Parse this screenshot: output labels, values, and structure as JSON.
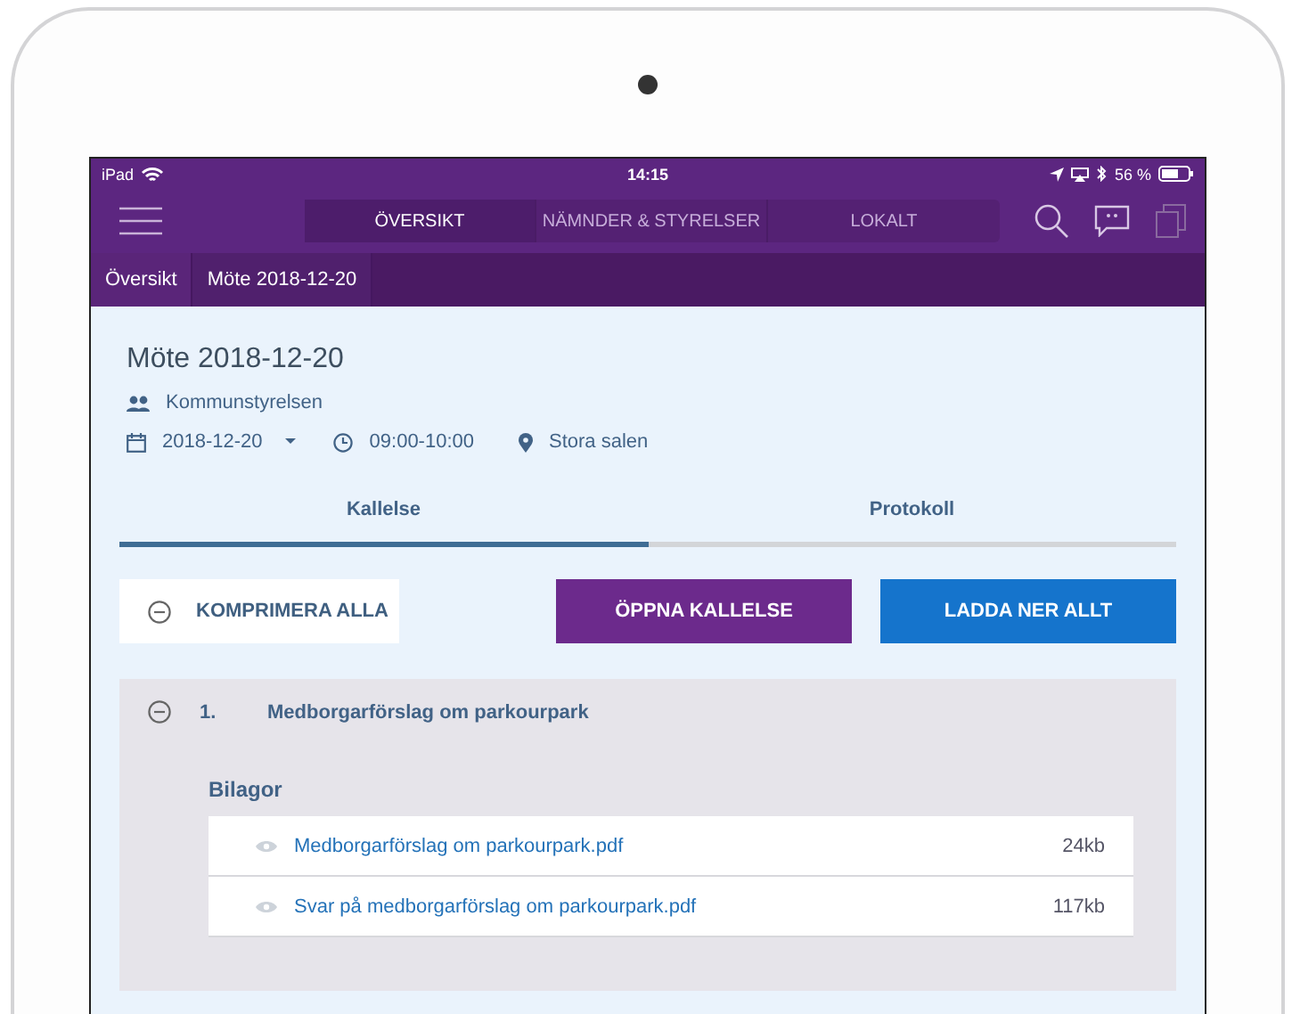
{
  "status_bar": {
    "device": "iPad",
    "time": "14:15",
    "battery": "56 %"
  },
  "nav_tabs": [
    {
      "label": "ÖVERSIKT",
      "selected": true
    },
    {
      "label": "NÄMNDER & STYRELSER",
      "selected": false
    },
    {
      "label": "LOKALT",
      "selected": false
    }
  ],
  "breadcrumbs": [
    {
      "label": "Översikt",
      "selected": false
    },
    {
      "label": "Möte 2018-12-20",
      "selected": true
    }
  ],
  "meeting": {
    "title": "Möte 2018-12-20",
    "committee": "Kommunstyrelsen",
    "date": "2018-12-20",
    "time": "09:00-10:00",
    "location": "Stora salen"
  },
  "tabs": [
    {
      "label": "Kallelse",
      "selected": true
    },
    {
      "label": "Protokoll",
      "selected": false
    }
  ],
  "actions": {
    "collapse_all": "KOMPRIMERA ALLA",
    "open_notice": "ÖPPNA KALLELSE",
    "download_all": "LADDA NER ALLT"
  },
  "agenda": [
    {
      "number": "1.",
      "title": "Medborgarförslag om parkourpark",
      "expanded": true,
      "attachments_heading": "Bilagor",
      "attachments": [
        {
          "name": "Medborgarförslag om parkourpark.pdf",
          "size": "24kb"
        },
        {
          "name": "Svar på medborgarförslag om parkourpark.pdf",
          "size": "117kb"
        }
      ]
    }
  ]
}
